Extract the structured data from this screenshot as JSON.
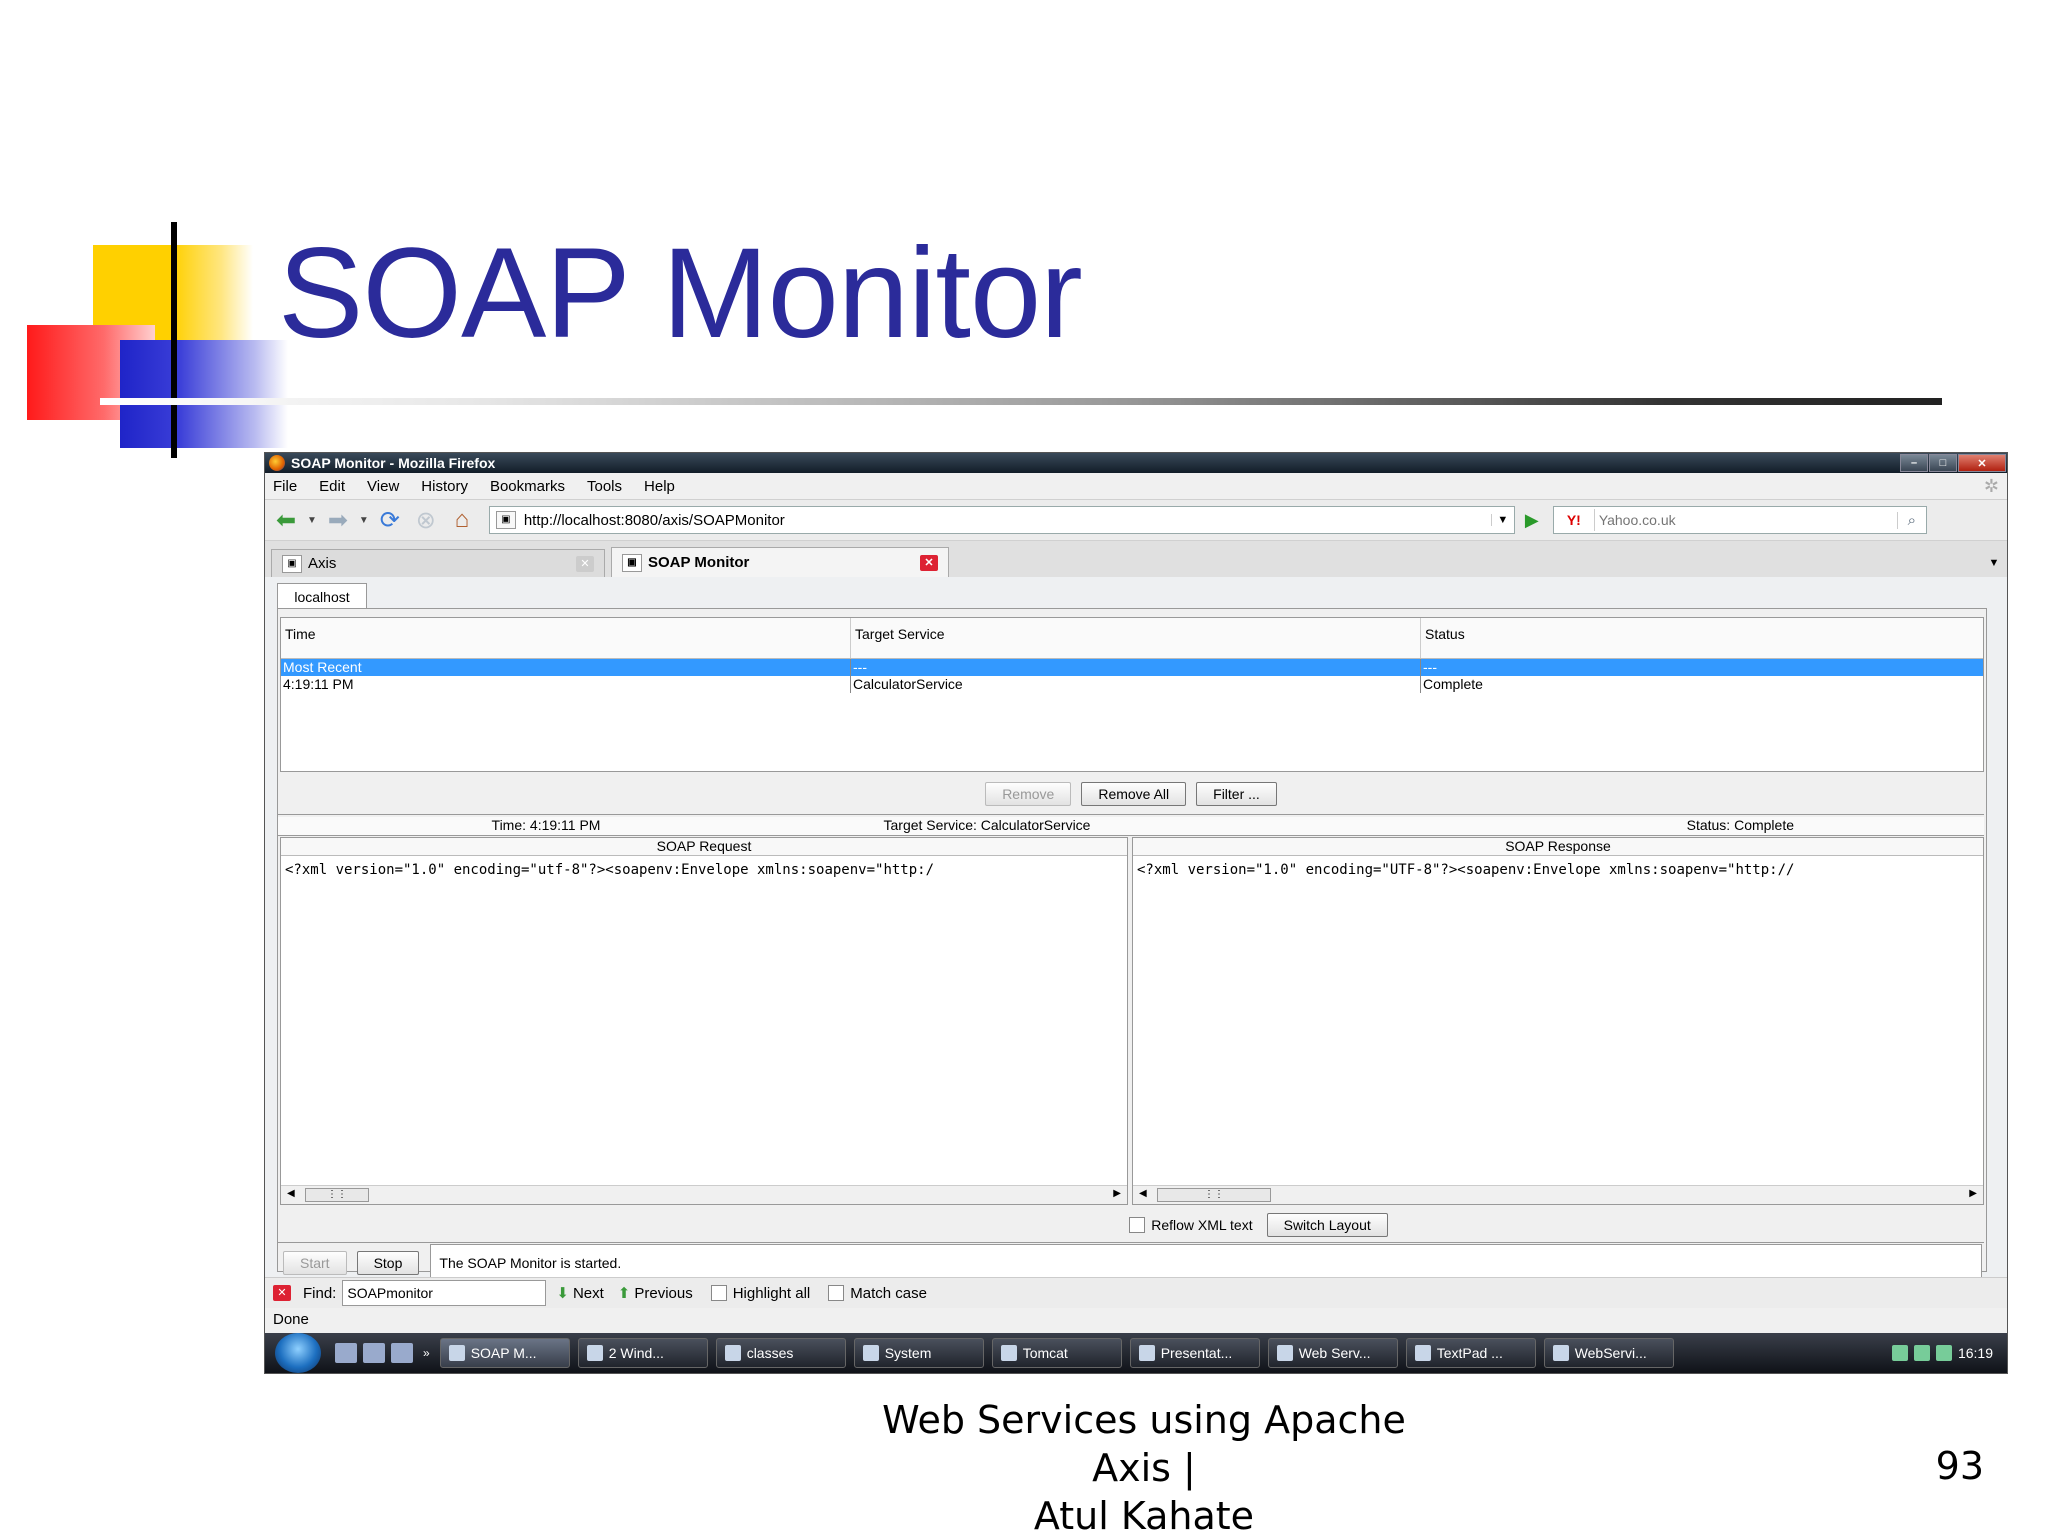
{
  "slide": {
    "title": "SOAP Monitor",
    "footer_line1": "Web Services using Apache Axis |",
    "footer_line2": "Atul Kahate",
    "page_number": "93"
  },
  "window": {
    "title": "SOAP Monitor - Mozilla Firefox",
    "menu": [
      "File",
      "Edit",
      "View",
      "History",
      "Bookmarks",
      "Tools",
      "Help"
    ],
    "url": "http://localhost:8080/axis/SOAPMonitor",
    "search_placeholder": "Yahoo.co.uk",
    "search_engine": "Y!",
    "tabs": [
      {
        "label": "Axis",
        "active": false
      },
      {
        "label": "SOAP Monitor",
        "active": true
      }
    ]
  },
  "monitor": {
    "host_tab": "localhost",
    "columns": [
      "Time",
      "Target Service",
      "Status"
    ],
    "rows": [
      {
        "time": "Most Recent",
        "service": "---",
        "status": "---",
        "selected": true
      },
      {
        "time": "4:19:11 PM",
        "service": "CalculatorService",
        "status": "Complete",
        "selected": false
      }
    ],
    "buttons": {
      "remove": "Remove",
      "remove_all": "Remove All",
      "filter": "Filter ..."
    },
    "info": {
      "time": "Time: 4:19:11 PM",
      "target": "Target Service: CalculatorService",
      "status": "Status: Complete"
    },
    "request": {
      "header": "SOAP Request",
      "body": "<?xml version=\"1.0\" encoding=\"utf-8\"?><soapenv:Envelope xmlns:soapenv=\"http:/"
    },
    "response": {
      "header": "SOAP Response",
      "body": "<?xml version=\"1.0\" encoding=\"UTF-8\"?><soapenv:Envelope xmlns:soapenv=\"http://"
    },
    "reflow_label": "Reflow XML text",
    "switch_layout": "Switch Layout",
    "start": "Start",
    "stop": "Stop",
    "status_message": "The SOAP Monitor is started."
  },
  "findbar": {
    "label": "Find:",
    "value": "SOAPmonitor",
    "next": "Next",
    "previous": "Previous",
    "highlight": "Highlight all",
    "match_case": "Match case"
  },
  "statusbar": {
    "text": "Done"
  },
  "taskbar": {
    "items": [
      "SOAP M...",
      "2 Wind...",
      "classes",
      "System",
      "Tomcat",
      "Presentat...",
      "Web Serv...",
      "TextPad ...",
      "WebServi..."
    ],
    "chevron": "»",
    "clock": "16:19"
  },
  "colors": {
    "title": "#2b2b9a",
    "selection": "#3399ff"
  }
}
